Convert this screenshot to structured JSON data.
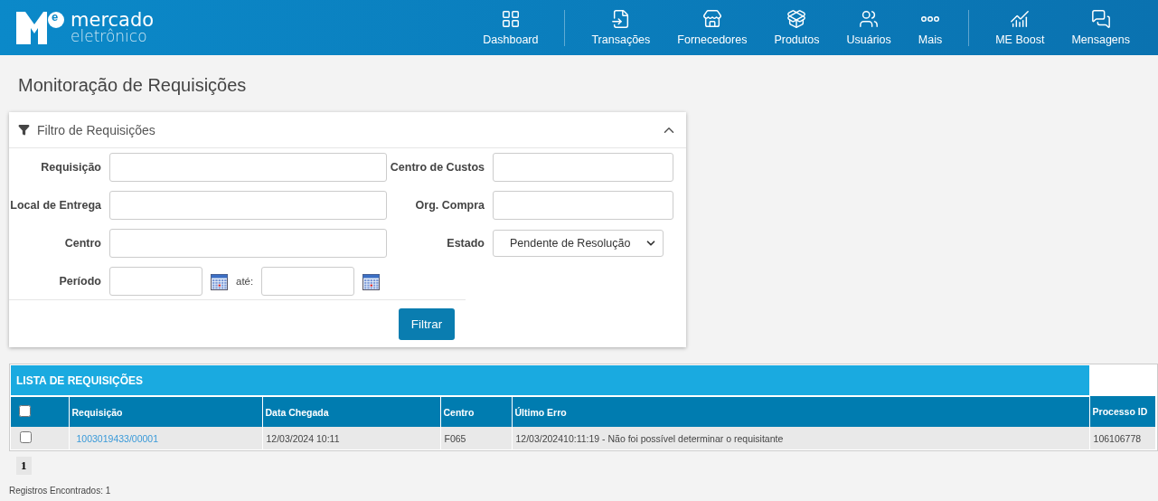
{
  "brand": {
    "mark": "e",
    "line1": "mercado",
    "line2": "eletrônico"
  },
  "nav": [
    {
      "label": "Dashboard"
    },
    {
      "label": "Transações"
    },
    {
      "label": "Fornecedores"
    },
    {
      "label": "Produtos"
    },
    {
      "label": "Usuários"
    },
    {
      "label": "Mais"
    },
    {
      "label": "ME Boost"
    },
    {
      "label": "Mensagens"
    }
  ],
  "page_title": "Monitoração de Requisições",
  "filter": {
    "title": "Filtro de Requisições",
    "expanded": true,
    "left": [
      {
        "kind": "text",
        "label": "Requisição"
      },
      {
        "kind": "text",
        "label": "Local de Entrega"
      },
      {
        "kind": "text",
        "label": "Centro"
      },
      {
        "kind": "period",
        "label": "Período",
        "separator": "até:"
      }
    ],
    "right": [
      {
        "kind": "text",
        "label": "Centro de Custos"
      },
      {
        "kind": "text",
        "label": "Org. Compra"
      },
      {
        "kind": "select",
        "label": "Estado",
        "value": "Pendente de Resolução"
      }
    ],
    "button": "Filtrar"
  },
  "table": {
    "title": "LISTA DE REQUISIÇÕES",
    "select_all_checked": false,
    "columns": [
      "Requisição",
      "Data Chegada",
      "Centro",
      "Último Erro",
      "Processo ID"
    ],
    "rows": [
      {
        "checked": false,
        "cells": [
          "1003019433/00001",
          "12/03/2024 10:11",
          "F065",
          "12/03/202410:11:19 - Não foi possível determinar o requisitante",
          "106106778"
        ]
      }
    ]
  },
  "pages": [
    {
      "label": "1",
      "selected": true
    }
  ],
  "records": "Registros Encontrados: 1"
}
